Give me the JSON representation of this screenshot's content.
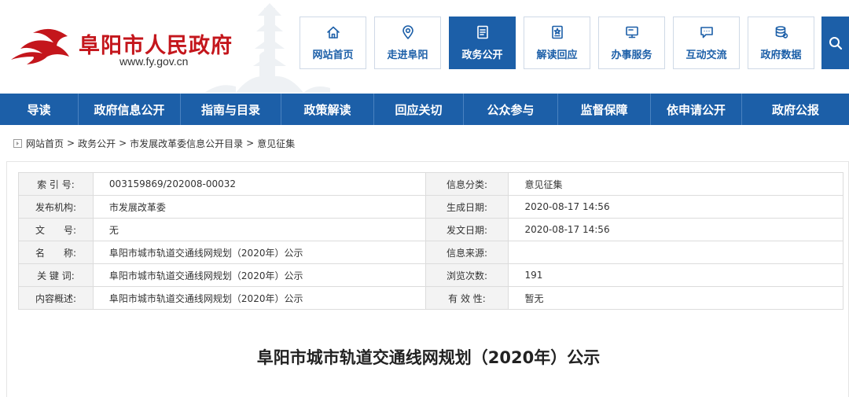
{
  "site": {
    "title": "阜阳市人民政府",
    "url": "www.fy.gov.cn"
  },
  "top_nav": [
    {
      "label": "网站首页",
      "icon": "home-icon",
      "active": false
    },
    {
      "label": "走进阜阳",
      "icon": "location-pin-icon",
      "active": false
    },
    {
      "label": "政务公开",
      "icon": "document-list-icon",
      "active": true
    },
    {
      "label": "解读回应",
      "icon": "star-document-icon",
      "active": false
    },
    {
      "label": "办事服务",
      "icon": "monitor-icon",
      "active": false
    },
    {
      "label": "互动交流",
      "icon": "chat-bubble-icon",
      "active": false
    },
    {
      "label": "政府数据",
      "icon": "database-icon",
      "active": false
    }
  ],
  "main_nav": [
    "导读",
    "政府信息公开",
    "指南与目录",
    "政策解读",
    "回应关切",
    "公众参与",
    "监督保障",
    "依申请公开",
    "政府公报"
  ],
  "breadcrumb": [
    "网站首页",
    "政务公开",
    "市发展改革委信息公开目录",
    "意见征集"
  ],
  "breadcrumb_sep": ">",
  "info_table": [
    {
      "k1": "索 引 号:",
      "v1": "003159869/202008-00032",
      "k2": "信息分类:",
      "v2": "意见征集"
    },
    {
      "k1": "发布机构:",
      "v1": "市发展改革委",
      "k2": "生成日期:",
      "v2": "2020-08-17 14:56"
    },
    {
      "k1": "文　　号:",
      "v1": "无",
      "k2": "发文日期:",
      "v2": "2020-08-17 14:56"
    },
    {
      "k1": "名　　称:",
      "v1": "阜阳市城市轨道交通线网规划（2020年）公示",
      "k2": "信息来源:",
      "v2": ""
    },
    {
      "k1": "关 键 词:",
      "v1": "阜阳市城市轨道交通线网规划（2020年）公示",
      "k2": "浏览次数:",
      "v2": "191"
    },
    {
      "k1": "内容概述:",
      "v1": "阜阳市城市轨道交通线网规划（2020年）公示",
      "k2": "有 效 性:",
      "v2": "暂无"
    }
  ],
  "article": {
    "title": "阜阳市城市轨道交通线网规划（2020年）公示"
  },
  "colors": {
    "brand_blue": "#1c5fa8",
    "logo_red": "#c4161c"
  }
}
